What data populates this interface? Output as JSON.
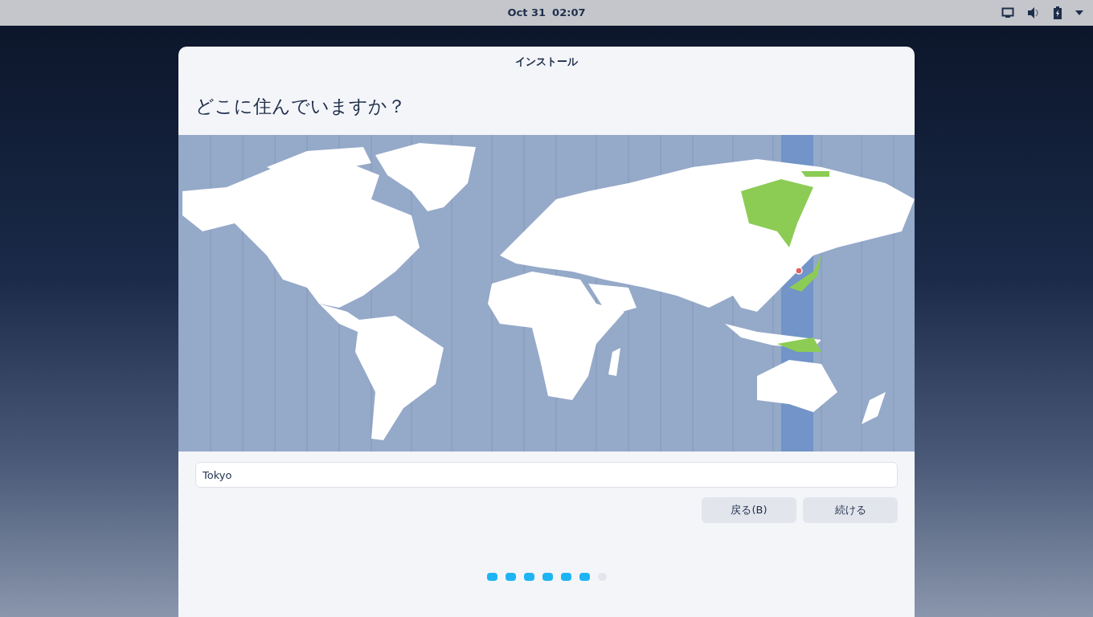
{
  "top_bar": {
    "date": "Oct 31",
    "time": "02:07"
  },
  "window": {
    "title": "インストール"
  },
  "heading": "どこに住んでいますか？",
  "location_field": {
    "value": "Tokyo"
  },
  "buttons": [
    {
      "label": "戻る(B)"
    },
    {
      "label": "続ける"
    }
  ],
  "steps": [
    {
      "done": true
    },
    {
      "done": true
    },
    {
      "done": true
    },
    {
      "done": true
    },
    {
      "done": true
    },
    {
      "done": true
    },
    {
      "done": false
    }
  ]
}
